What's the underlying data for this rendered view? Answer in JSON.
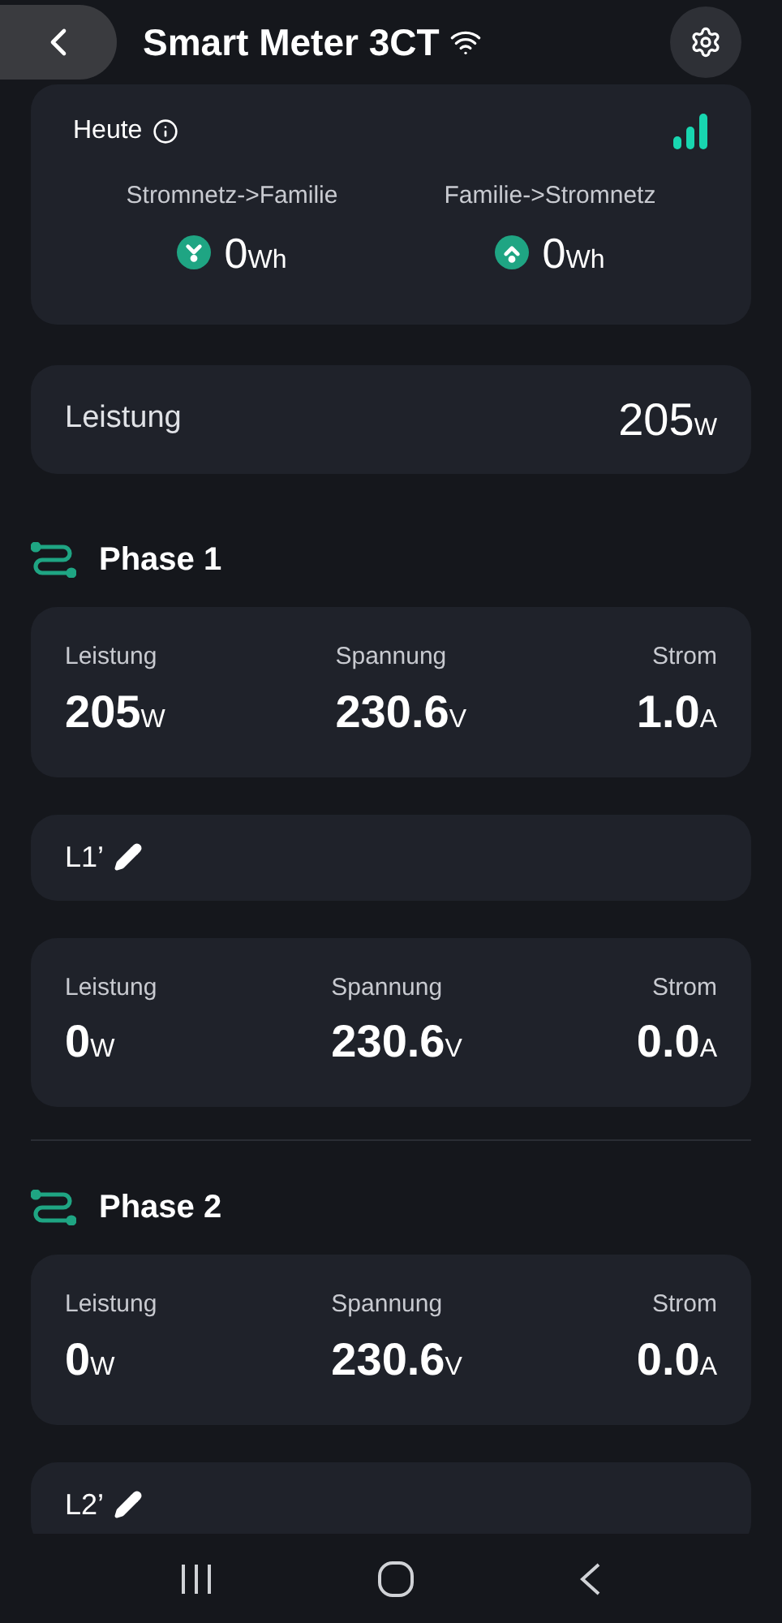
{
  "header": {
    "title": "Smart Meter 3CT"
  },
  "today": {
    "label": "Heute",
    "flows": [
      {
        "label": "Stromnetz->Familie",
        "value": "0",
        "unit": "Wh",
        "kind": "in"
      },
      {
        "label": "Familie->Stromnetz",
        "value": "0",
        "unit": "Wh",
        "kind": "out"
      }
    ]
  },
  "power": {
    "label": "Leistung",
    "value": "205",
    "unit": "W"
  },
  "phases": [
    {
      "title": "Phase 1",
      "items": [
        {
          "kind": "metrics",
          "metrics": [
            {
              "label": "Leistung",
              "value": "205",
              "unit": "W"
            },
            {
              "label": "Spannung",
              "value": "230.6",
              "unit": "V"
            },
            {
              "label": "Strom",
              "value": "1.0",
              "unit": "A"
            }
          ]
        },
        {
          "kind": "line",
          "label": "L1’"
        },
        {
          "kind": "metrics",
          "metrics": [
            {
              "label": "Leistung",
              "value": "0",
              "unit": "W"
            },
            {
              "label": "Spannung",
              "value": "230.6",
              "unit": "V"
            },
            {
              "label": "Strom",
              "value": "0.0",
              "unit": "A"
            }
          ]
        }
      ]
    },
    {
      "title": "Phase 2",
      "items": [
        {
          "kind": "metrics",
          "metrics": [
            {
              "label": "Leistung",
              "value": "0",
              "unit": "W"
            },
            {
              "label": "Spannung",
              "value": "230.6",
              "unit": "V"
            },
            {
              "label": "Strom",
              "value": "0.0",
              "unit": "A"
            }
          ]
        },
        {
          "kind": "line",
          "label": "L2’"
        }
      ]
    }
  ]
}
